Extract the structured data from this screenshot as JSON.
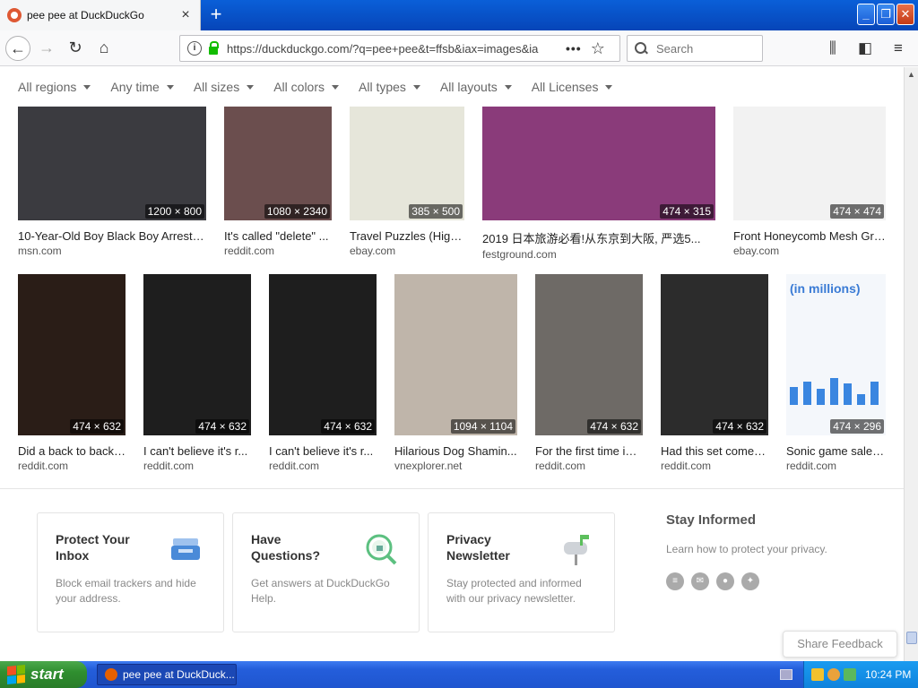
{
  "browser": {
    "tab_title": "pee pee at DuckDuckGo",
    "tab_close": "×",
    "new_tab": "+",
    "url": "https://duckduckgo.com/?q=pee+pee&t=ffsb&iax=images&ia",
    "search_placeholder": "Search",
    "win_min": "_",
    "win_max": "❐",
    "win_close": "✕"
  },
  "filters": [
    "All regions",
    "Any time",
    "All sizes",
    "All colors",
    "All types",
    "All layouts",
    "All Licenses"
  ],
  "row1": [
    {
      "title": "10-Year-Old Boy Black Boy Arreste...",
      "domain": "msn.com",
      "dim": "1200 × 800",
      "color": "#3b3b40"
    },
    {
      "title": "It's called \"delete\" ...",
      "domain": "reddit.com",
      "dim": "1080 × 2340",
      "color": "#6b4e4e"
    },
    {
      "title": "Travel Puzzles (Highl...",
      "domain": "ebay.com",
      "dim": "385 × 500",
      "color": "#e6e6da"
    },
    {
      "title": "2019 日本旅游必看!从东京到大阪, 严选5...",
      "domain": "festground.com",
      "dim": "474 × 315",
      "color": "#8a3b7a"
    },
    {
      "title": "Front Honeycomb Mesh Gril...",
      "domain": "ebay.com",
      "dim": "474 × 474",
      "color": "#f2f2f2"
    }
  ],
  "row2": [
    {
      "title": "Did a back to back ...",
      "domain": "reddit.com",
      "dim": "474 × 632",
      "color": "#2a1d17"
    },
    {
      "title": "I can't believe it's r...",
      "domain": "reddit.com",
      "dim": "474 × 632",
      "color": "#1e1e1e"
    },
    {
      "title": "I can't believe it's r...",
      "domain": "reddit.com",
      "dim": "474 × 632",
      "color": "#1e1e1e"
    },
    {
      "title": "Hilarious Dog Shamin...",
      "domain": "vnexplorer.net",
      "dim": "1094 × 1104",
      "color": "#bfb5aa"
    },
    {
      "title": "For the first time in ...",
      "domain": "reddit.com",
      "dim": "474 × 632",
      "color": "#6e6a66"
    },
    {
      "title": "Had this set come i...",
      "domain": "reddit.com",
      "dim": "474 × 632",
      "color": "#2c2c2c"
    },
    {
      "title": "Sonic game sales...",
      "domain": "reddit.com",
      "dim": "474 × 296",
      "color": "#f4f7fb",
      "overlay": "(in millions)"
    }
  ],
  "cards": [
    {
      "title": "Protect Your Inbox",
      "desc": "Block email trackers and hide your address."
    },
    {
      "title": "Have Questions?",
      "desc": "Get answers at DuckDuckGo Help."
    },
    {
      "title": "Privacy Newsletter",
      "desc": "Stay protected and informed with our privacy newsletter."
    }
  ],
  "stay": {
    "title": "Stay Informed",
    "desc": "Learn how to protect your privacy."
  },
  "feedback": "Share Feedback",
  "taskbar": {
    "start": "start",
    "item": "pee pee at DuckDuck...",
    "clock": "10:24 PM"
  }
}
